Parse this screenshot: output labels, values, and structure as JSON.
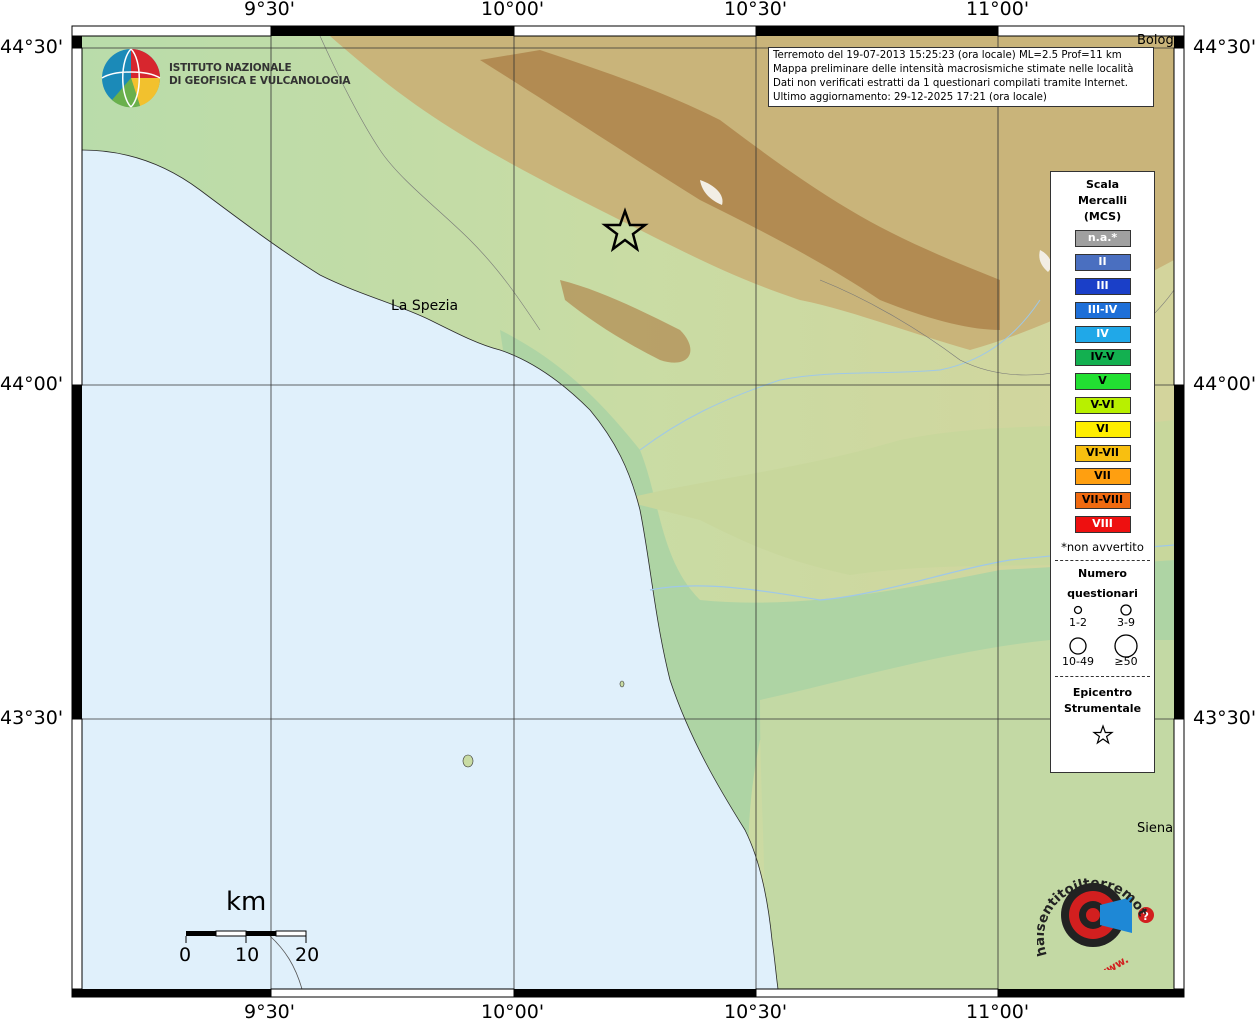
{
  "colors": {
    "sea": "#e0f0fb",
    "lowland": "#a9d2a3",
    "hills": "#d8d6a0",
    "mountains": "#b88a4c",
    "frame": "#000000"
  },
  "graticule": {
    "top_labels": [
      "9°30'",
      "10°00'",
      "10°30'",
      "11°00'"
    ],
    "bottom_labels": [
      "9°30'",
      "10°00'",
      "10°30'",
      "11°00'"
    ],
    "left_labels": [
      "44°30'",
      "44°00'",
      "43°30'"
    ],
    "right_labels": [
      "44°30'",
      "44°00'",
      "43°30'"
    ]
  },
  "institute": {
    "line1": "ISTITUTO NAZIONALE",
    "line2": "DI GEOFISICA E VULCANOLOGIA"
  },
  "info": {
    "line1": "Terremoto del 19-07-2013 15:25:23 (ora locale) ML=2.5 Prof=11 km",
    "line2": "Mappa preliminare delle intensità macrosismiche stimate nelle località",
    "line3": "Dati non verificati estratti da 1 questionari compilati tramite Internet.",
    "line4": "Ultimo aggiornamento: 29-12-2025 17:21 (ora locale)"
  },
  "places": {
    "la_spezia": "La Spezia",
    "bologna_partial": "Bolog",
    "siena_partial": "Siena"
  },
  "legend": {
    "scale_title_1": "Scala",
    "scale_title_2": "Mercalli",
    "scale_title_3": "(MCS)",
    "intensities": [
      {
        "label": "n.a.*",
        "color": "#a0a0a0",
        "text": "#ffffff"
      },
      {
        "label": "II",
        "color": "#4a6fc0",
        "text": "#ffffff"
      },
      {
        "label": "III",
        "color": "#1a3fc8",
        "text": "#ffffff"
      },
      {
        "label": "III-IV",
        "color": "#1e6fd8",
        "text": "#ffffff"
      },
      {
        "label": "IV",
        "color": "#20a8e8",
        "text": "#ffffff"
      },
      {
        "label": "IV-V",
        "color": "#13b050",
        "text": "#000000"
      },
      {
        "label": "V",
        "color": "#22e032",
        "text": "#000000"
      },
      {
        "label": "V-VI",
        "color": "#b8f000",
        "text": "#000000"
      },
      {
        "label": "VI",
        "color": "#ffee00",
        "text": "#000000"
      },
      {
        "label": "VI-VII",
        "color": "#f8bf10",
        "text": "#000000"
      },
      {
        "label": "VII",
        "color": "#ff9f10",
        "text": "#000000"
      },
      {
        "label": "VII-VIII",
        "color": "#f06a10",
        "text": "#000000"
      },
      {
        "label": "VIII",
        "color": "#ee1010",
        "text": "#ffffff"
      }
    ],
    "not_felt_note": "*non avvertito",
    "questionnaires_title_1": "Numero",
    "questionnaires_title_2": "questionari",
    "size_1": "1-2",
    "size_2": "3-9",
    "size_3": "10-49",
    "size_4": "≥50",
    "epicenter_title_1": "Epicentro",
    "epicenter_title_2": "Strumentale"
  },
  "scalebar": {
    "unit": "km",
    "ticks": [
      "0",
      "10",
      "20"
    ]
  },
  "brand": {
    "text": "haisentitoilterremoto.it",
    "url_text": "www."
  }
}
